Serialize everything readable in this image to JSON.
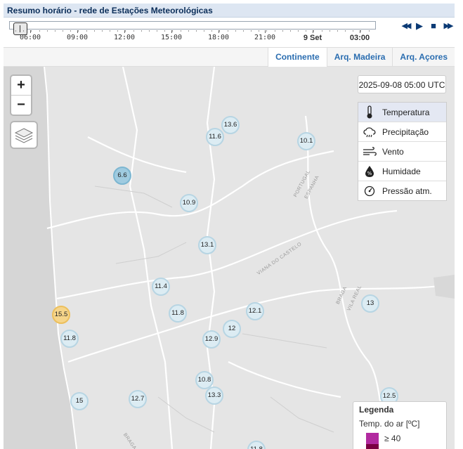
{
  "header": {
    "title": "Resumo horário - rede de Estações Meteorológicas"
  },
  "timeline": {
    "labels": [
      "06:00",
      "09:00",
      "12:00",
      "15:00",
      "18:00",
      "21:00",
      "9 Set",
      "03:00"
    ],
    "controls": [
      {
        "name": "rewind-icon",
        "glyph": "◀◀"
      },
      {
        "name": "play-icon",
        "glyph": "▶"
      },
      {
        "name": "stop-icon",
        "glyph": "■"
      },
      {
        "name": "fast-forward-icon",
        "glyph": "▶▶"
      }
    ]
  },
  "tabs": [
    "Continente",
    "Arq. Madeira",
    "Arq. Açores"
  ],
  "map": {
    "timestamp": "2025-09-08 05:00 UTC",
    "zoom_in": "+",
    "zoom_out": "−",
    "variables": [
      {
        "label": "Temperatura",
        "icon": "thermometer-icon"
      },
      {
        "label": "Precipitação",
        "icon": "rain-cloud-icon"
      },
      {
        "label": "Vento",
        "icon": "wind-icon"
      },
      {
        "label": "Humidade",
        "icon": "humidity-icon"
      },
      {
        "label": "Pressão atm.",
        "icon": "pressure-gauge-icon"
      }
    ],
    "stations": [
      "13.6",
      "11.6",
      "10.1",
      "6.6",
      "10.9",
      "13.1",
      "11.4",
      "15.5",
      "11.8",
      "12.1",
      "13",
      "11.8",
      "12",
      "12.9",
      "10.8",
      "13.3",
      "15",
      "12.7",
      "12.5",
      "11.8"
    ],
    "map_labels": [
      "PORTUGAL",
      "ESPANHA",
      "VIANA DO CASTELO",
      "BRAGA",
      "VILA REAL",
      "BRAGA"
    ]
  },
  "legend": {
    "title": "Legenda",
    "subtitle": "Temp. do ar [ºC]",
    "first_bin": "≥ 40"
  },
  "colors": {
    "accent": "#2a6db0",
    "cold": "#9fcbe0",
    "mild": "#dcecf3",
    "warm": "#f6d58a",
    "legend_top": "#b22aa0"
  }
}
